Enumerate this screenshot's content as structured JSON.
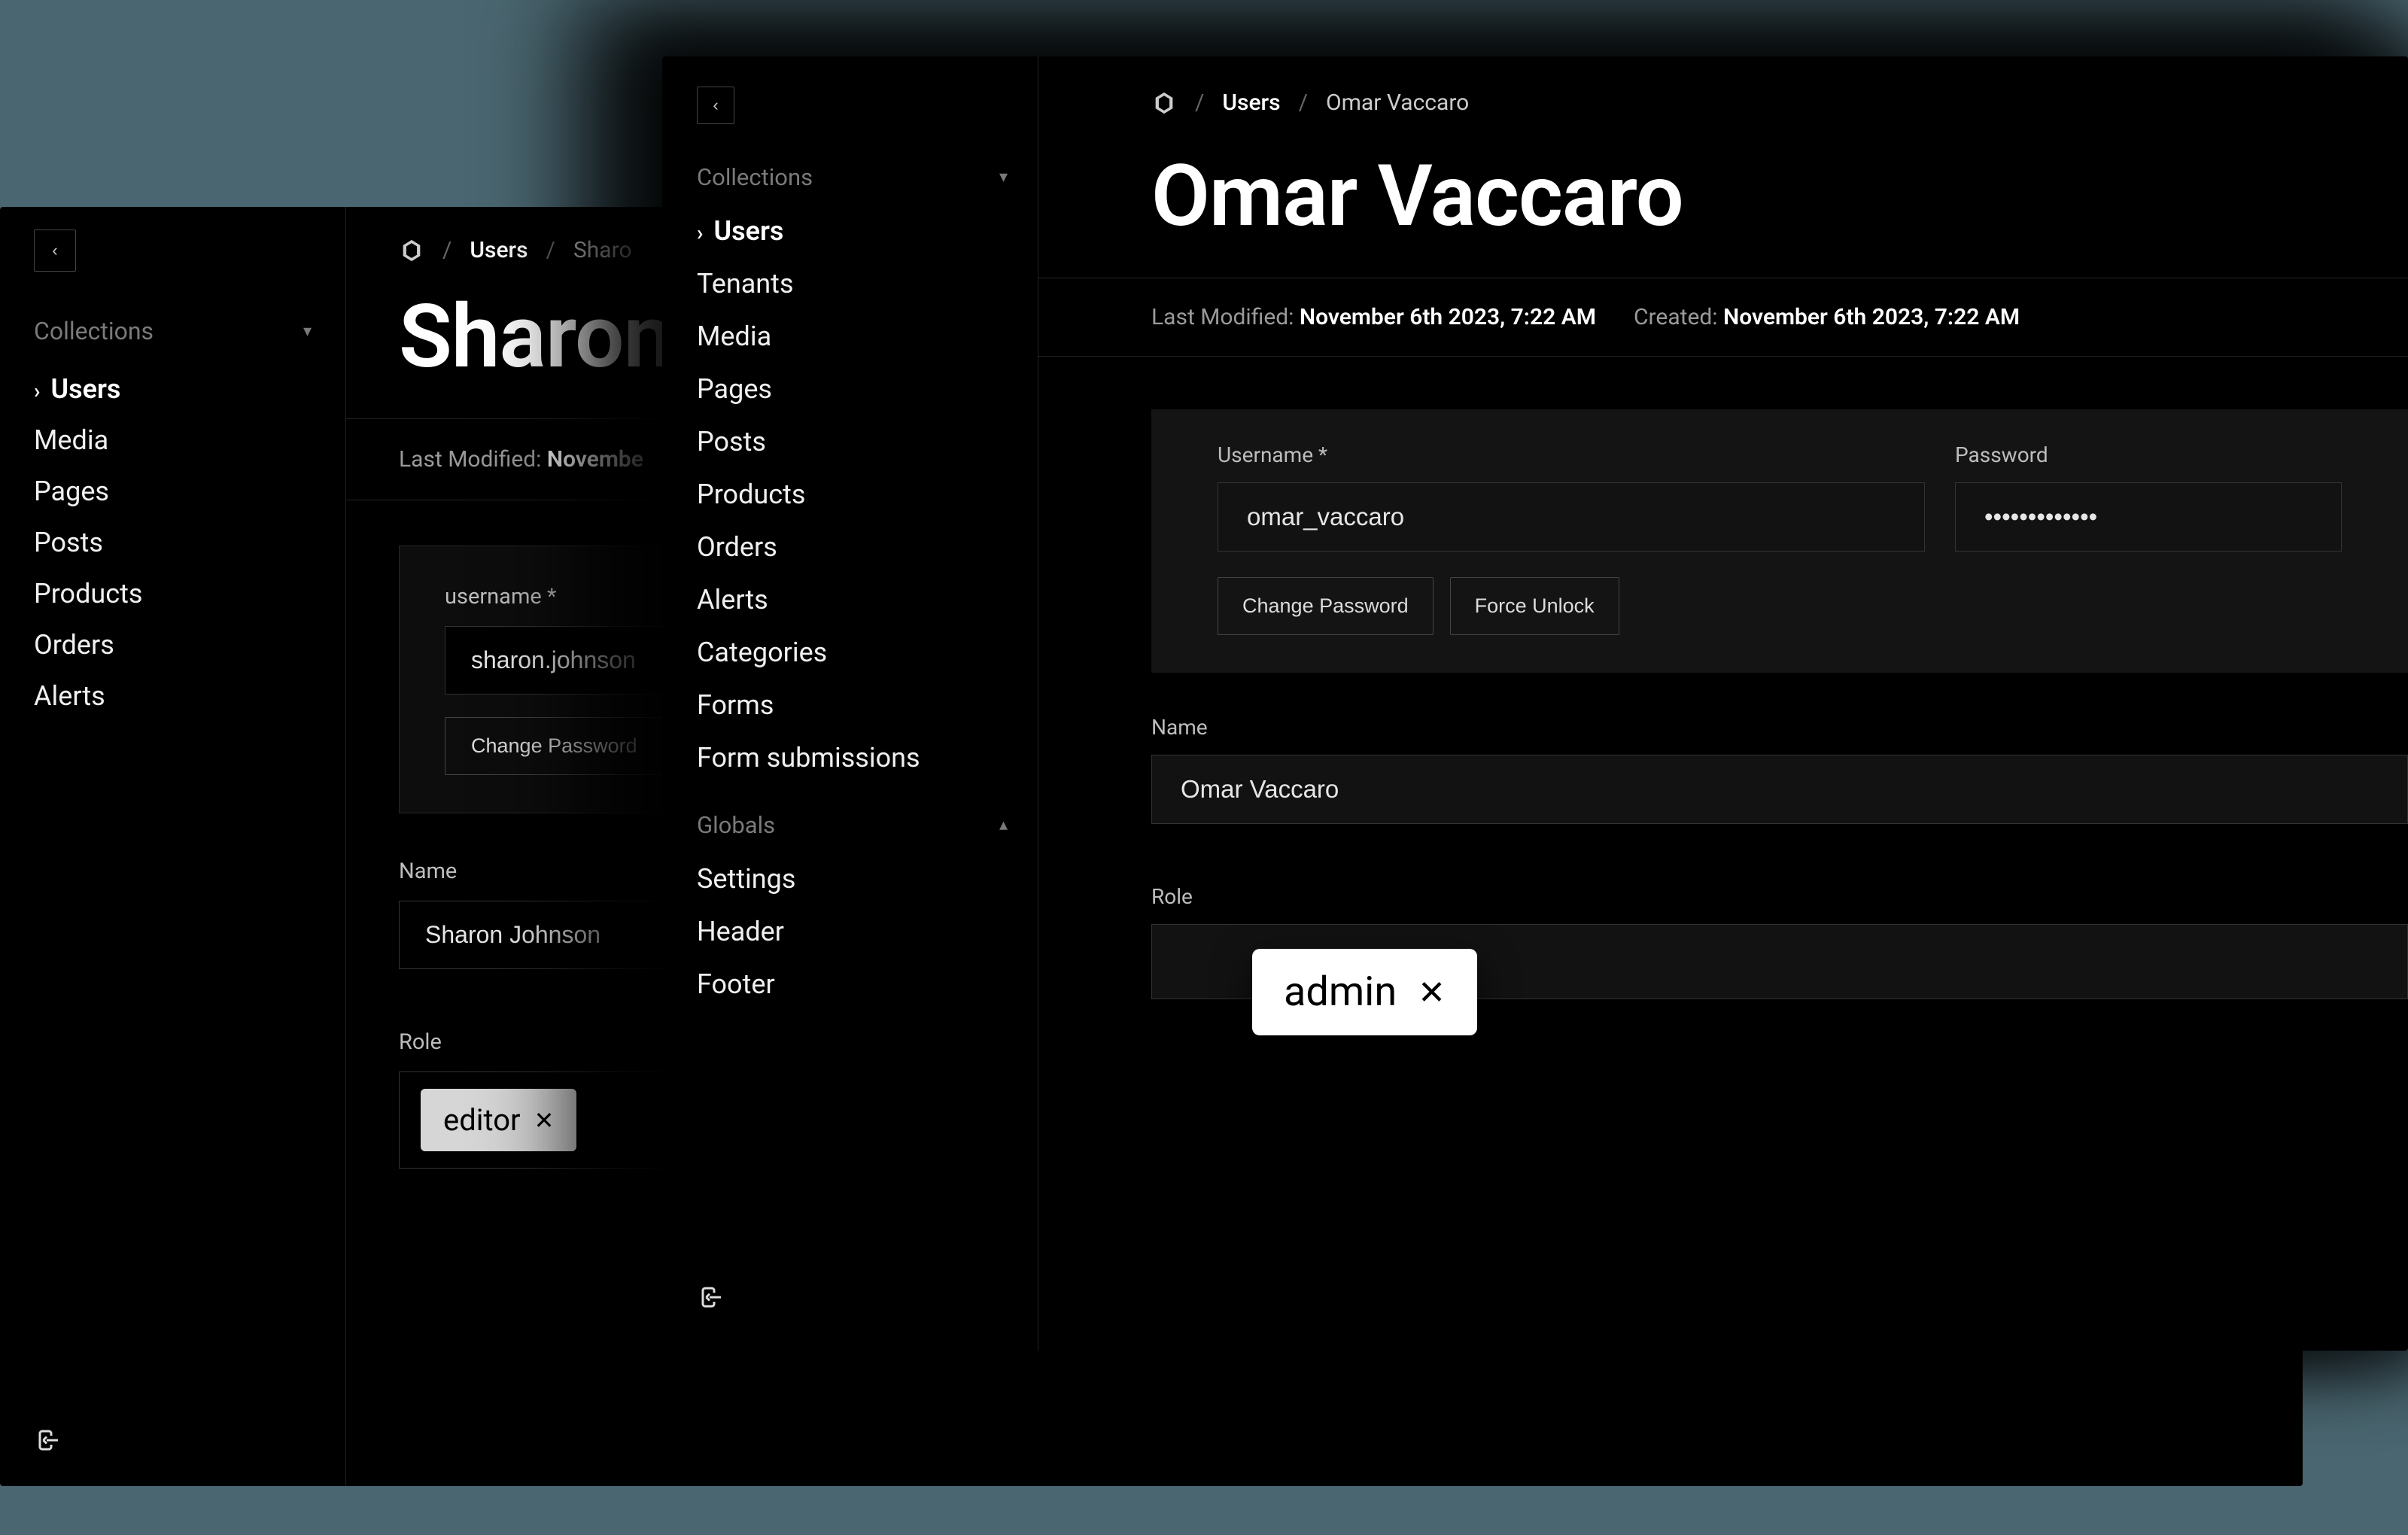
{
  "rear": {
    "sidebar": {
      "collections_label": "Collections",
      "items": [
        "Users",
        "Media",
        "Pages",
        "Posts",
        "Products",
        "Orders",
        "Alerts"
      ],
      "active_index": 0
    },
    "breadcrumb": {
      "collection": "Users",
      "current": "Sharo"
    },
    "page_title": "Sharon",
    "meta": {
      "last_modified_label": "Last Modified:",
      "last_modified_value": "Novembe"
    },
    "form": {
      "username_label": "username",
      "username_value": "sharon.johnson",
      "change_password_label": "Change Password",
      "name_label": "Name",
      "name_value": "Sharon Johnson",
      "role_label": "Role",
      "role_tag": "editor"
    }
  },
  "front": {
    "sidebar": {
      "collections_label": "Collections",
      "items": [
        "Users",
        "Tenants",
        "Media",
        "Pages",
        "Posts",
        "Products",
        "Orders",
        "Alerts",
        "Categories",
        "Forms",
        "Form submissions"
      ],
      "active_index": 0,
      "globals_label": "Globals",
      "globals": [
        "Settings",
        "Header",
        "Footer"
      ]
    },
    "breadcrumb": {
      "collection": "Users",
      "current": "Omar Vaccaro"
    },
    "page_title": "Omar Vaccaro",
    "meta": {
      "last_modified_label": "Last Modified:",
      "last_modified_value": "November 6th 2023, 7:22 AM",
      "created_label": "Created:",
      "created_value": "November 6th 2023, 7:22 AM"
    },
    "form": {
      "username_label": "Username",
      "username_value": "omar_vaccaro",
      "password_label": "Password",
      "password_value": "•••••••••••••",
      "change_password_label": "Change Password",
      "force_unlock_label": "Force Unlock",
      "name_label": "Name",
      "name_value": "Omar Vaccaro",
      "role_label": "Role",
      "role_tag": "admin"
    }
  }
}
